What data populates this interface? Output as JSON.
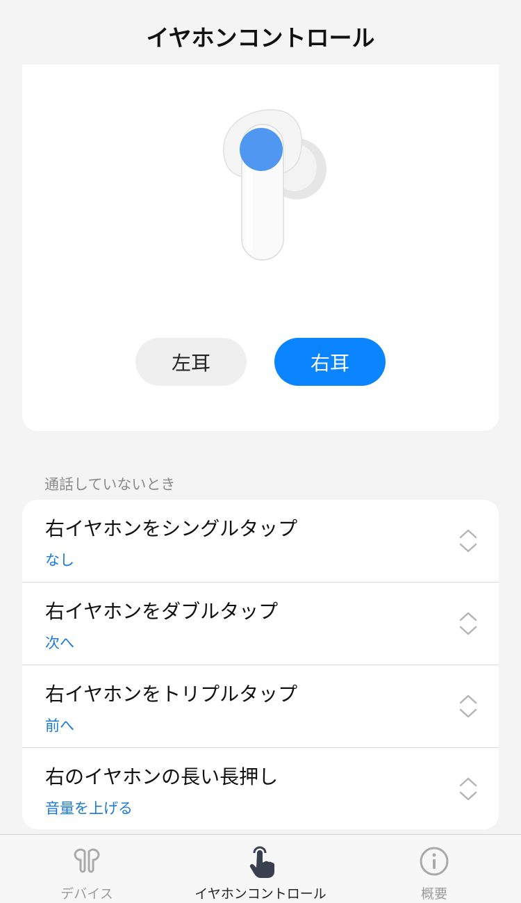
{
  "header": {
    "title": "イヤホンコントロール"
  },
  "earbud_selector": {
    "left_label": "左耳",
    "right_label": "右耳",
    "selected": "right"
  },
  "section": {
    "label": "通話していないとき"
  },
  "settings": [
    {
      "title": "右イヤホンをシングルタップ",
      "value": "なし"
    },
    {
      "title": "右イヤホンをダブルタップ",
      "value": "次へ"
    },
    {
      "title": "右イヤホンをトリプルタップ",
      "value": "前へ"
    },
    {
      "title": "右のイヤホンの長い長押し",
      "value": "音量を上げる"
    }
  ],
  "tab_bar": {
    "tabs": [
      {
        "label": "デバイス",
        "icon": "earbuds-icon",
        "active": false
      },
      {
        "label": "イヤホンコントロール",
        "icon": "tap-hand-icon",
        "active": true
      },
      {
        "label": "概要",
        "icon": "info-icon",
        "active": false
      }
    ]
  },
  "colors": {
    "accent": "#0a84ff",
    "value_text": "#1a7ad8",
    "tap_indicator": "#4f97f0",
    "background": "#f4f4f4"
  }
}
